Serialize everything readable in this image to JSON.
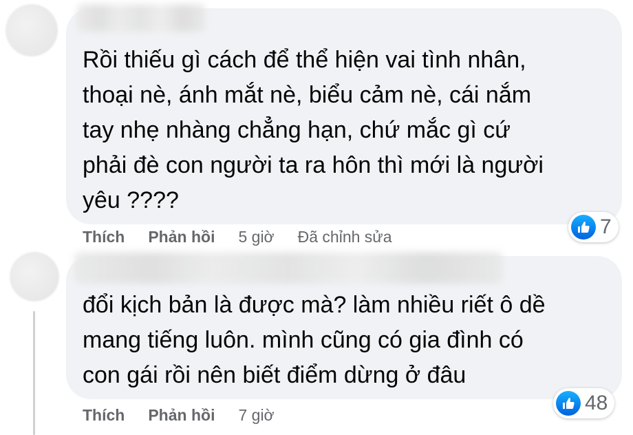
{
  "comments": [
    {
      "text": "Rồi thiếu gì cách để thể hiện vai tình nhân,\nthoại nè, ánh mắt nè, biểu cảm nè, cái nắm\ntay nhẹ nhàng chẳng hạn, chứ mắc gì cứ\nphải đè con người ta ra hôn thì mới là người\nyêu ????",
      "like_label": "Thích",
      "reply_label": "Phản hồi",
      "time": "5 giờ",
      "edited": "Đã chỉnh sửa",
      "reaction_count": "7",
      "reaction_icon": "like-icon"
    },
    {
      "text": "đổi kịch bản là được mà? làm nhiều riết ô dề\nmang tiếng luôn. mình cũng có gia đình có\ncon gái rồi nên biết điểm dừng ở đâu",
      "like_label": "Thích",
      "reply_label": "Phản hồi",
      "time": "7 giờ",
      "reaction_count": "48",
      "reaction_icon": "like-icon"
    }
  ],
  "colors": {
    "bubble": "#f0f2f5",
    "text": "#050505",
    "secondary_text": "#65676b",
    "like_blue": "#0571ed"
  }
}
